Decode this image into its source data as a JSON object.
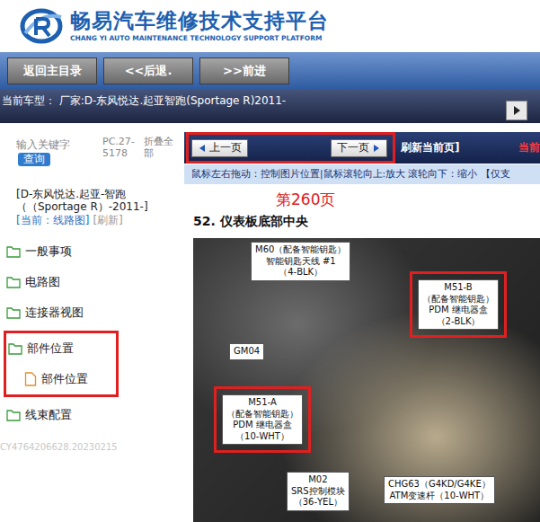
{
  "header": {
    "title": "畅易汽车维修技术支持平台",
    "subtitle": "CHANG YI AUTO MAINTENANCE TECHNOLOGY SUPPORT PLATFORM"
  },
  "nav": {
    "buttons": [
      "返回主目录",
      "<<后退.",
      ">>前进"
    ]
  },
  "vehicle_bar": {
    "text": "当前车型：  厂家:D-东风悦达.起亚智跑(Sportage R)2011-"
  },
  "sidebar": {
    "search_placeholder": "输入关键字",
    "search_button": "查询",
    "code": "PC.27-5178",
    "collapse": "折叠全部",
    "vehicle": "[D-东风悦达.起亚-智跑（（Sportage R）-2011-]",
    "current": "[当前：线路图]",
    "refresh": "[刷新]",
    "tree": [
      {
        "label": "一般事项",
        "kind": "folder",
        "level": 0,
        "highlighted": false
      },
      {
        "label": "电路图",
        "kind": "folder",
        "level": 0,
        "highlighted": false
      },
      {
        "label": "连接器视图",
        "kind": "folder",
        "level": 0,
        "highlighted": false
      },
      {
        "label": "部件位置",
        "kind": "folder",
        "level": 0,
        "highlighted": true
      },
      {
        "label": "部件位置",
        "kind": "doc",
        "level": 1,
        "highlighted": true
      },
      {
        "label": "线束配置",
        "kind": "folder",
        "level": 0,
        "highlighted": false
      }
    ],
    "watermark": "CY4764206628.20230215"
  },
  "viewer": {
    "pager": {
      "prev": "上一页",
      "next": "下一页",
      "highlighted": true
    },
    "refresh": "刷新当前页]",
    "current_cut": "当前",
    "hint": "鼠标左右拖动：控制图片位置|鼠标滚轮向上:放大  滚轮向下：缩小 【仅支",
    "page_label": "第260页",
    "section_title": "52. 仪表板底部中央",
    "callouts": [
      {
        "lines": [
          "M60（配备智能钥匙）",
          "智能钥匙天线 #1",
          "（4-BLK）"
        ],
        "highlighted": false
      },
      {
        "lines": [
          "M51-B",
          "（配备智能钥匙）",
          "PDM 继电器盒",
          "（2-BLK）"
        ],
        "highlighted": true
      },
      {
        "lines": [
          "GM04"
        ],
        "highlighted": false
      },
      {
        "lines": [
          "M51-A",
          "（配备智能钥匙）",
          "PDM 继电器盒",
          "（10-WHT）"
        ],
        "highlighted": true
      },
      {
        "lines": [
          "M02",
          "SRS控制模块",
          "（36-YEL）"
        ],
        "highlighted": false
      },
      {
        "lines": [
          "CHG63（G4KD/G4KE）",
          "ATM变速杆（10-WHT）"
        ],
        "highlighted": false
      }
    ]
  }
}
